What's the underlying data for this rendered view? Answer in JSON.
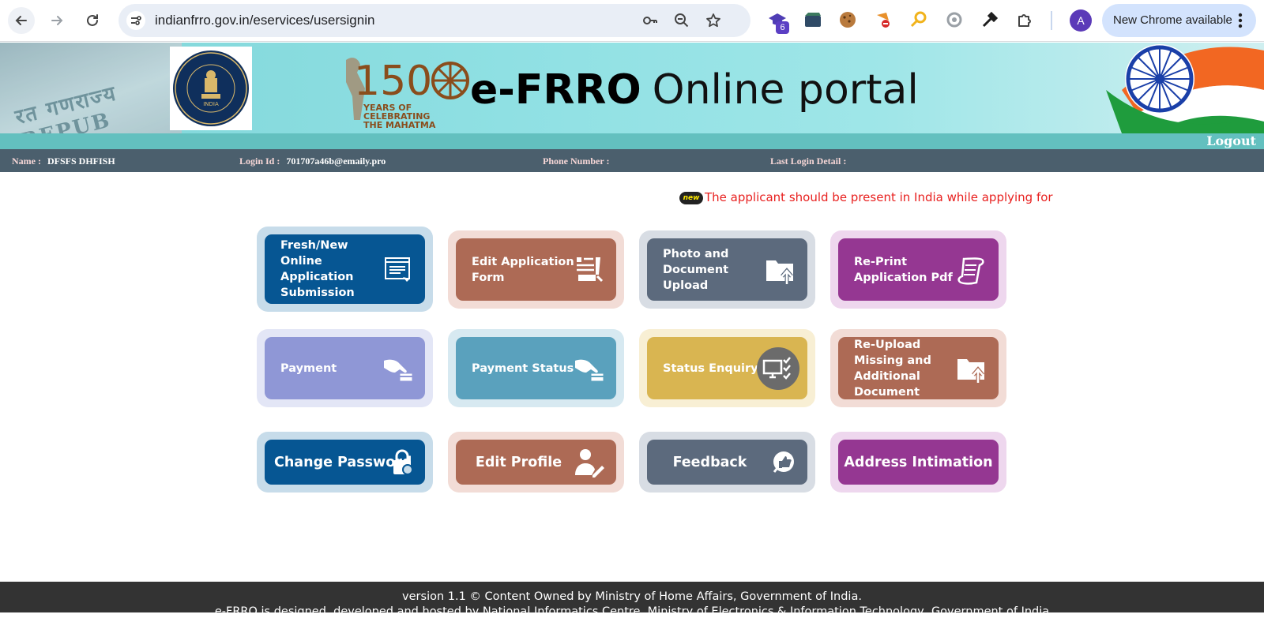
{
  "browser": {
    "url": "indianfrro.gov.in/eservices/usersignin",
    "extension_badge": "6",
    "profile_initial": "A",
    "update_label": "New Chrome available"
  },
  "header": {
    "emblem_text": "BUREAU OF IMMIGRATION · MINISTRY OF HOME AFFAIRS · INDIA",
    "anniversary_number": "150",
    "anniversary_text": "YEARS OF CELEBRATING THE MAHATMA",
    "brand_bold": "e-FRRO",
    "brand_rest": "Online portal",
    "logout_label": "Logout"
  },
  "user_info": {
    "name_label": "Name :",
    "name_value": "DFSFS DHFISH",
    "login_label": "Login Id :",
    "login_value": "701707a46b@emaily.pro",
    "phone_label": "Phone Number :",
    "phone_value": "",
    "last_login_label": "Last Login Detail :",
    "last_login_value": ""
  },
  "notice": {
    "badge": "new",
    "text": "The applicant should be present in India while applying for"
  },
  "tiles": [
    {
      "label": "Fresh/New Online Application Submission",
      "icon": "form-screen-icon"
    },
    {
      "label": "Edit Application Form",
      "icon": "edit-form-icon"
    },
    {
      "label": "Photo and Document Upload",
      "icon": "folder-upload-icon"
    },
    {
      "label": "Re-Print Application Pdf",
      "icon": "scroll-icon"
    },
    {
      "label": "Payment",
      "icon": "hand-card-icon"
    },
    {
      "label": "Payment Status",
      "icon": "hand-card-icon"
    },
    {
      "label": "Status Enquiry",
      "icon": "monitor-check-icon"
    },
    {
      "label": "Re-Upload Missing and Additional Document",
      "icon": "folder-upload-icon"
    },
    {
      "label": "Change Password",
      "icon": "lock-icon"
    },
    {
      "label": "Edit Profile",
      "icon": "user-edit-icon"
    },
    {
      "label": "Feedback",
      "icon": "thumbs-up-icon"
    },
    {
      "label": "Address Intimation",
      "icon": ""
    }
  ],
  "footer": {
    "line1": "version 1.1 © Content Owned by Ministry of Home Affairs, Government of India.",
    "line2": "e-FRRO is designed, developed and hosted by National Informatics Centre, Ministry of Electronics & Information Technology, Government of India"
  }
}
